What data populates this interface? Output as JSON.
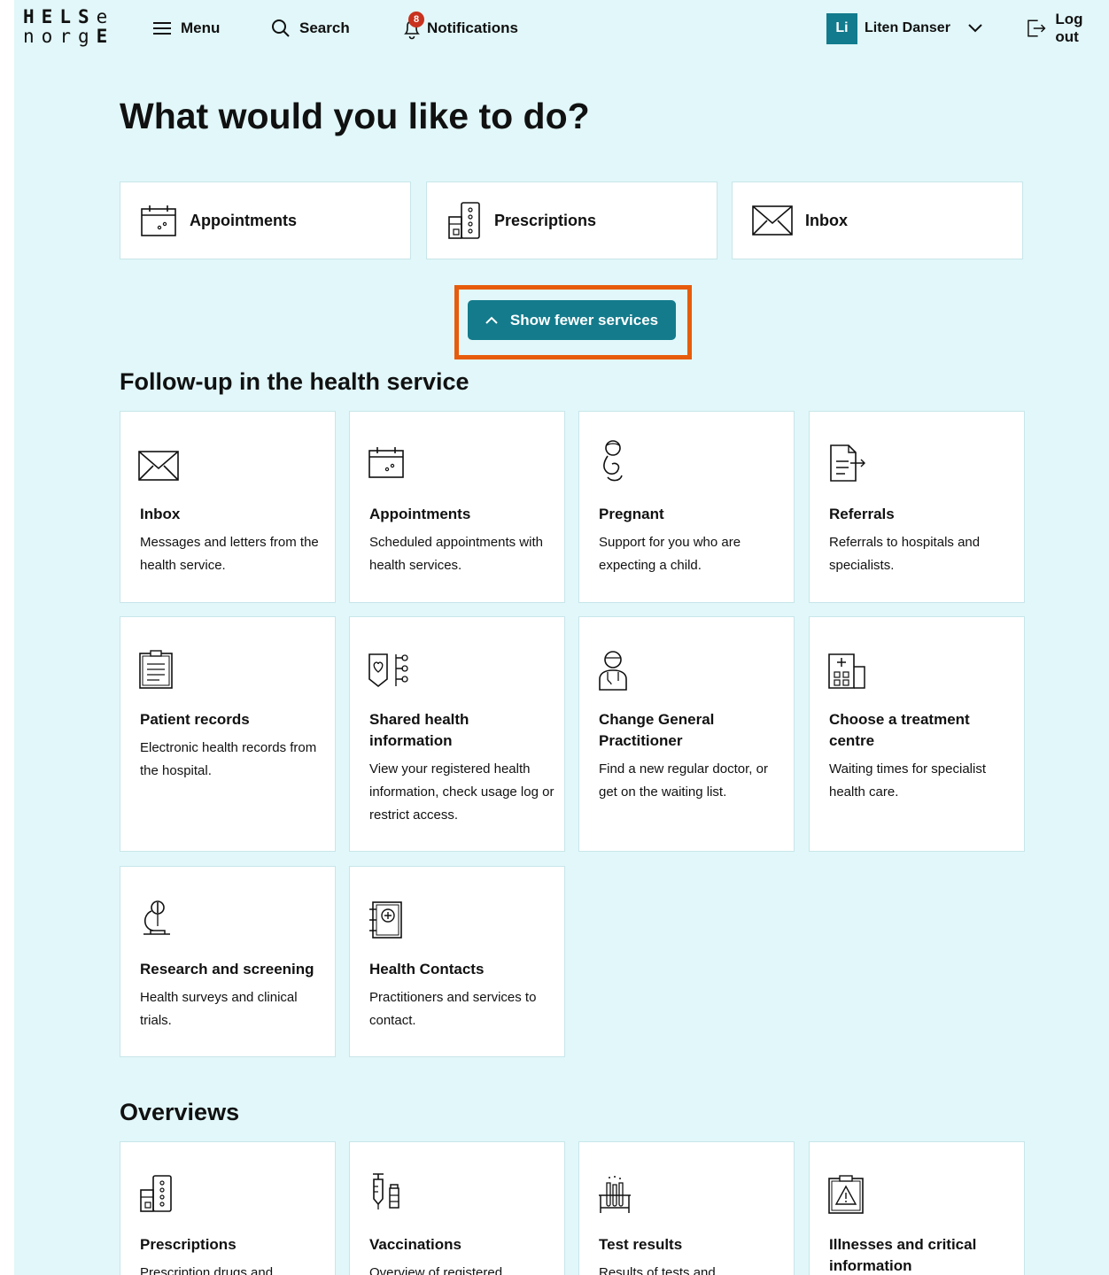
{
  "header": {
    "logo_top": "HELSe",
    "logo_bottom": "norgE",
    "menu_label": "Menu",
    "search_label": "Search",
    "notifications_label": "Notifications",
    "notifications_count": "8",
    "user_initials": "Li",
    "user_name": "Liten Danser",
    "logout_label": "Log out"
  },
  "main": {
    "title": "What would you like to do?",
    "quick_links": [
      {
        "label": "Appointments",
        "icon": "calendar-icon"
      },
      {
        "label": "Prescriptions",
        "icon": "prescription-icon"
      },
      {
        "label": "Inbox",
        "icon": "envelope-icon"
      }
    ],
    "toggle_button_label": "Show fewer services"
  },
  "followup": {
    "heading": "Follow-up in the health service",
    "cards": [
      {
        "title": "Inbox",
        "desc": "Messages and letters from the health service.",
        "icon": "envelope-icon"
      },
      {
        "title": "Appointments",
        "desc": "Scheduled appointments with health services.",
        "icon": "calendar-icon"
      },
      {
        "title": "Pregnant",
        "desc": "Support for you who are expecting a child.",
        "icon": "pregnant-icon"
      },
      {
        "title": "Referrals",
        "desc": "Referrals to hospitals and specialists.",
        "icon": "referral-icon"
      },
      {
        "title": "Patient records",
        "desc": "Electronic health records from the hospital.",
        "icon": "clipboard-icon"
      },
      {
        "title": "Shared health information",
        "desc": "View your registered health information, check usage log or restrict access.",
        "icon": "shared-info-icon"
      },
      {
        "title": "Change General Practitioner",
        "desc": "Find a new regular doctor, or get on the waiting list.",
        "icon": "doctor-icon"
      },
      {
        "title": "Choose a treatment centre",
        "desc": "Waiting times for specialist health care.",
        "icon": "hospital-icon"
      },
      {
        "title": "Research and screening",
        "desc": "Health surveys and clinical trials.",
        "icon": "microscope-icon"
      },
      {
        "title": "Health Contacts",
        "desc": "Practitioners and services to contact.",
        "icon": "contacts-book-icon"
      }
    ]
  },
  "overviews": {
    "heading": "Overviews",
    "cards": [
      {
        "title": "Prescriptions",
        "desc": "Prescription drugs and",
        "icon": "prescription-icon"
      },
      {
        "title": "Vaccinations",
        "desc": "Overview of registered",
        "icon": "vaccine-icon"
      },
      {
        "title": "Test results",
        "desc": "Results of tests and",
        "icon": "test-tubes-icon"
      },
      {
        "title": "Illnesses and critical information",
        "desc": "",
        "icon": "warning-clipboard-icon"
      }
    ]
  },
  "colors": {
    "background": "#e1f7f9",
    "accent": "#137b8c",
    "highlight": "#e75c0c",
    "badge": "#c8321e"
  }
}
